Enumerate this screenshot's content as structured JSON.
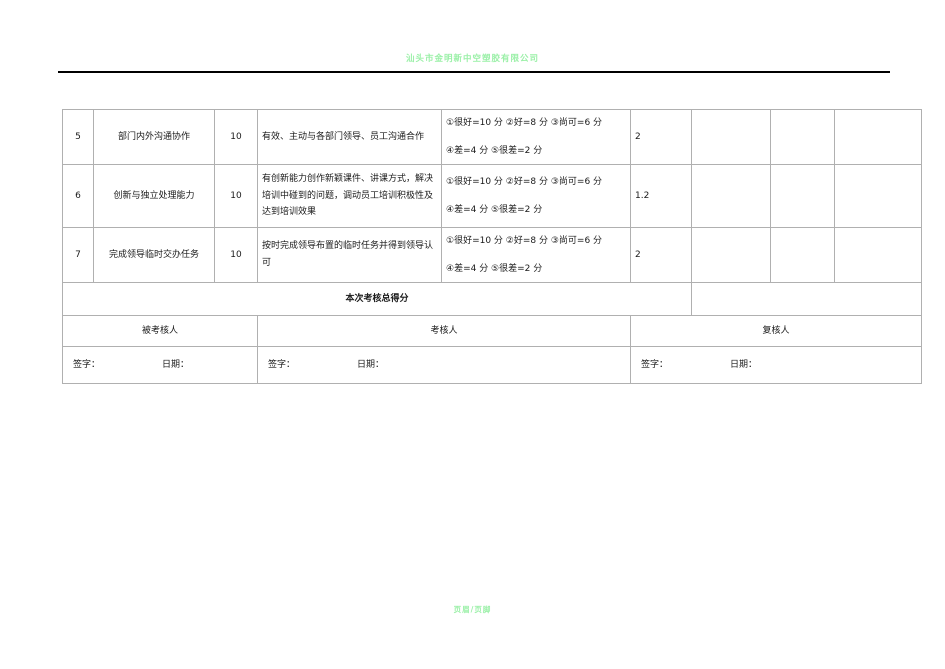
{
  "document": {
    "header_watermark": "汕头市金明新中空塑胶有限公司",
    "footer_watermark": "页眉/页脚"
  },
  "table": {
    "scoring_standard": {
      "line1": "①很好=10  分  ②好=8  分    ③尚可=6  分",
      "line2": "④差=4 分  ⑤很差=2 分"
    },
    "rows": [
      {
        "no": "5",
        "item": "部门内外沟通协作",
        "weight": "10",
        "description": "有效、主动与各部门领导、员工沟通合作",
        "std_line1": "①很好=10  分  ②好=8  分    ③尚可=6  分",
        "std_line2": "④差=4 分  ⑤很差=2 分",
        "self_score": "2",
        "blank1": "",
        "blank2": "",
        "blank3": ""
      },
      {
        "no": "6",
        "item": "创新与独立处理能力",
        "weight": "10",
        "description": "有创新能力创作新颖课件、讲课方式，解决培训中碰到的问题，调动员工培训积极性及达到培训效果",
        "std_line1": "①很好=10  分  ②好=8  分    ③尚可=6  分",
        "std_line2": "④差=4 分  ⑤很差=2 分",
        "self_score": "1.2",
        "blank1": "",
        "blank2": "",
        "blank3": ""
      },
      {
        "no": "7",
        "item": "完成领导临时交办任务",
        "weight": "10",
        "description": "按时完成领导布置的临时任务并得到领导认可",
        "std_line1": "①很好=10  分  ②好=8  分    ③尚可=6  分",
        "std_line2": "④差=4 分  ⑤很差=2 分",
        "self_score": "2",
        "blank1": "",
        "blank2": "",
        "blank3": ""
      }
    ],
    "total_row": {
      "label": "本次考核总得分",
      "value": ""
    },
    "signature_section": {
      "roles": [
        {
          "title": "被考核人",
          "sign_label": "签字：",
          "date_label": "日期："
        },
        {
          "title": "考核人",
          "sign_label": "签字：",
          "date_label": "日期："
        },
        {
          "title": "复核人",
          "sign_label": "签字：",
          "date_label": "日期："
        }
      ]
    }
  }
}
